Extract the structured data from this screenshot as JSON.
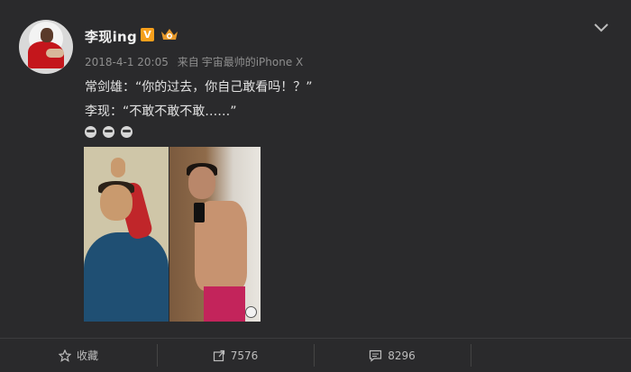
{
  "post": {
    "username": "李现ing",
    "vip_badge": "V",
    "timestamp": "2018-4-1 20:05",
    "source_prefix": "来自",
    "source": "宇宙最帅的iPhone X",
    "lines": [
      "常剑雄：“你的过去，你自己敢看吗！？”",
      "李现：“不敢不敢不敢……”"
    ],
    "emoji_count": 3
  },
  "actions": {
    "favorite_label": "收藏",
    "share_count": "7576",
    "comment_count": "8296"
  },
  "colors": {
    "background": "#2a2a2c",
    "vip_badge": "#f7a01c",
    "crown": "#e99a2a"
  },
  "icons": {
    "favorite": "star-icon",
    "share": "share-icon",
    "comment": "comment-icon",
    "menu": "chevron-down-icon"
  }
}
